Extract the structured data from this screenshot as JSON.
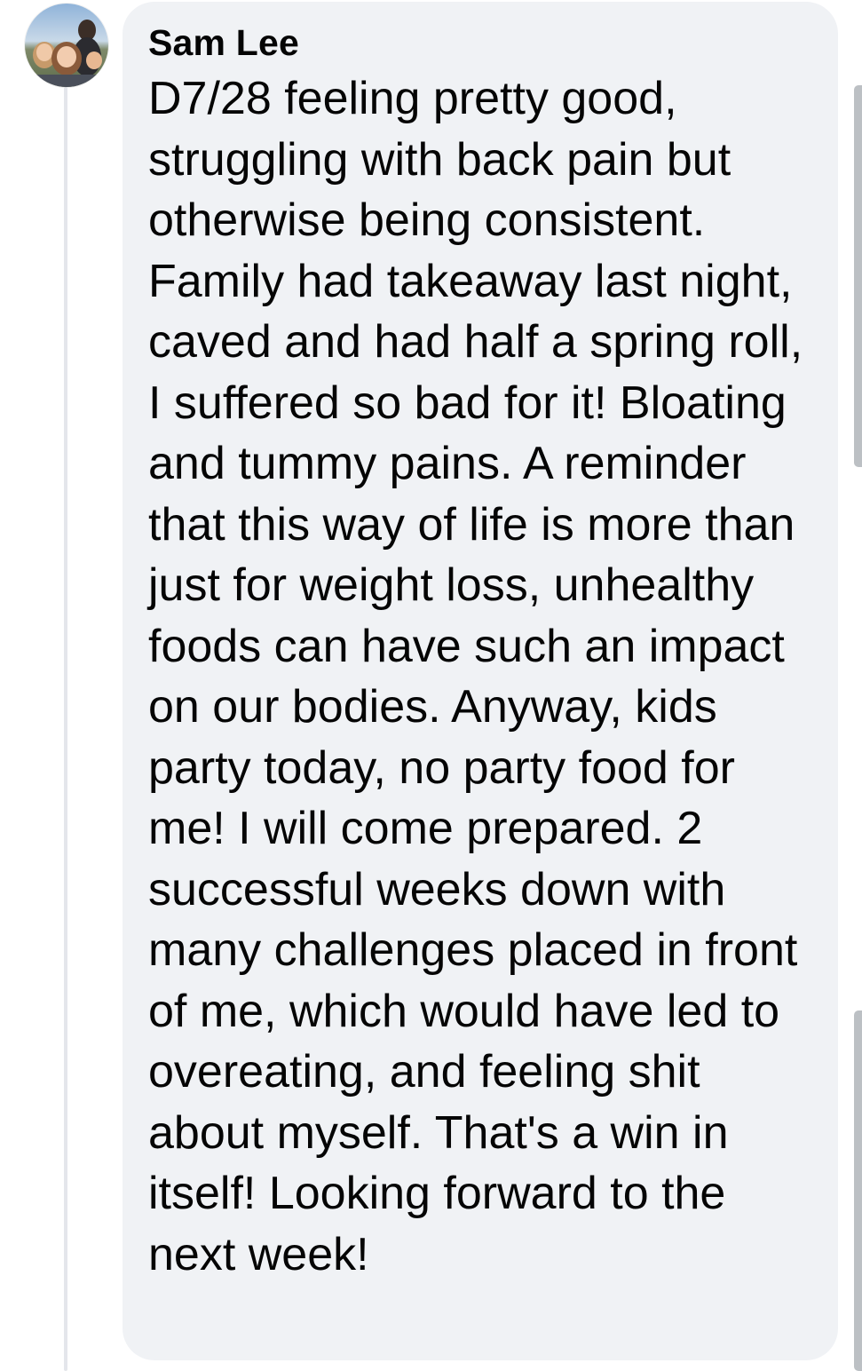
{
  "comment": {
    "author": "Sam Lee",
    "text": "D7/28 feeling pretty good, struggling with back pain but otherwise being consistent. Family had takeaway last night, caved and had half a spring roll, I suffered so bad for it! Bloating and tummy pains. A reminder that this way of life is more than just for weight loss, unhealthy foods can have such an impact on our bodies. Anyway, kids party today, no party food for me! I will come prepared. 2 successful weeks down with many challenges placed in front of me, which would have led to overeating, and feeling shit about myself. That's a win in itself! Looking forward to the next week!"
  },
  "icons": {
    "avatar": "profile-photo-avatar"
  },
  "colors": {
    "bubble_background": "#f0f2f5",
    "text": "#050505",
    "thread_line": "#e4e6eb",
    "scroll_handle": "#bcc0c4"
  }
}
